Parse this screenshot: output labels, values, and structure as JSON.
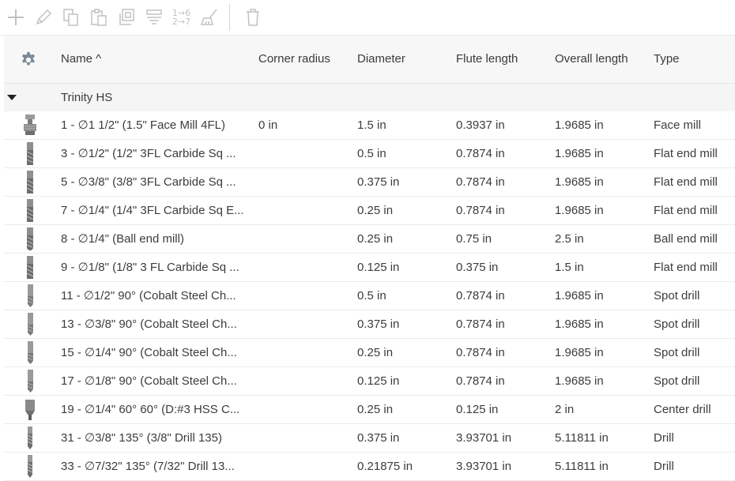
{
  "toolbar": {
    "buttons": [
      {
        "name": "add-icon"
      },
      {
        "name": "edit-icon"
      },
      {
        "name": "copy-icon"
      },
      {
        "name": "paste-icon"
      },
      {
        "name": "duplicate-icon"
      },
      {
        "name": "stack-icon"
      },
      {
        "name": "renumber-icon",
        "label_top": "1→6",
        "label_bottom": "2→7"
      },
      {
        "name": "clean-icon"
      },
      {
        "name": "delete-icon"
      }
    ]
  },
  "table": {
    "columns": {
      "name": "Name ^",
      "corner_radius": "Corner radius",
      "diameter": "Diameter",
      "flute_length": "Flute length",
      "overall_length": "Overall length",
      "type": "Type"
    },
    "group": {
      "label": "Trinity HS"
    },
    "rows": [
      {
        "icon": "face-mill-icon",
        "name": "1 - ∅1 1/2\" (1.5\" Face Mill 4FL)",
        "corner_radius": "0 in",
        "diameter": "1.5 in",
        "flute_length": "0.3937 in",
        "overall_length": "1.9685 in",
        "type": "Face mill"
      },
      {
        "icon": "flat-end-mill-icon",
        "name": "3 - ∅1/2\" (1/2\" 3FL Carbide Sq ...",
        "corner_radius": "",
        "diameter": "0.5 in",
        "flute_length": "0.7874 in",
        "overall_length": "1.9685 in",
        "type": "Flat end mill"
      },
      {
        "icon": "flat-end-mill-icon",
        "name": "5 - ∅3/8\" (3/8\" 3FL Carbide Sq ...",
        "corner_radius": "",
        "diameter": "0.375 in",
        "flute_length": "0.7874 in",
        "overall_length": "1.9685 in",
        "type": "Flat end mill"
      },
      {
        "icon": "flat-end-mill-icon",
        "name": "7 - ∅1/4\" (1/4\" 3FL Carbide Sq E...",
        "corner_radius": "",
        "diameter": "0.25 in",
        "flute_length": "0.7874 in",
        "overall_length": "1.9685 in",
        "type": "Flat end mill"
      },
      {
        "icon": "ball-end-mill-icon",
        "name": "8 - ∅1/4\" (Ball end mill)",
        "corner_radius": "",
        "diameter": "0.25 in",
        "flute_length": "0.75 in",
        "overall_length": "2.5 in",
        "type": "Ball end mill"
      },
      {
        "icon": "flat-end-mill-icon",
        "name": "9 - ∅1/8\" (1/8\" 3 FL Carbide Sq ...",
        "corner_radius": "",
        "diameter": "0.125 in",
        "flute_length": "0.375 in",
        "overall_length": "1.5 in",
        "type": "Flat end mill"
      },
      {
        "icon": "spot-drill-icon",
        "name": "11 - ∅1/2\" 90° (Cobalt Steel Ch...",
        "corner_radius": "",
        "diameter": "0.5 in",
        "flute_length": "0.7874 in",
        "overall_length": "1.9685 in",
        "type": "Spot drill"
      },
      {
        "icon": "spot-drill-icon",
        "name": "13 - ∅3/8\" 90° (Cobalt Steel Ch...",
        "corner_radius": "",
        "diameter": "0.375 in",
        "flute_length": "0.7874 in",
        "overall_length": "1.9685 in",
        "type": "Spot drill"
      },
      {
        "icon": "spot-drill-icon",
        "name": "15 - ∅1/4\" 90° (Cobalt Steel Ch...",
        "corner_radius": "",
        "diameter": "0.25 in",
        "flute_length": "0.7874 in",
        "overall_length": "1.9685 in",
        "type": "Spot drill"
      },
      {
        "icon": "spot-drill-icon",
        "name": "17 - ∅1/8\" 90° (Cobalt Steel Ch...",
        "corner_radius": "",
        "diameter": "0.125 in",
        "flute_length": "0.7874 in",
        "overall_length": "1.9685 in",
        "type": "Spot drill"
      },
      {
        "icon": "center-drill-icon",
        "name": "19 - ∅1/4\" 60° 60° (D:#3 HSS C...",
        "corner_radius": "",
        "diameter": "0.25 in",
        "flute_length": "0.125 in",
        "overall_length": "2 in",
        "type": "Center drill"
      },
      {
        "icon": "drill-icon",
        "name": "31 - ∅3/8\" 135° (3/8\" Drill 135)",
        "corner_radius": "",
        "diameter": "0.375 in",
        "flute_length": "3.93701 in",
        "overall_length": "5.11811 in",
        "type": "Drill"
      },
      {
        "icon": "drill-icon",
        "name": "33 - ∅7/32\" 135° (7/32\" Drill 13...",
        "corner_radius": "",
        "diameter": "0.21875 in",
        "flute_length": "3.93701 in",
        "overall_length": "5.11811 in",
        "type": "Drill"
      }
    ]
  },
  "colors": {
    "icon_disabled": "#c2c2c2",
    "header_bg": "#f7f7f7",
    "gear": "#7a8a99"
  }
}
